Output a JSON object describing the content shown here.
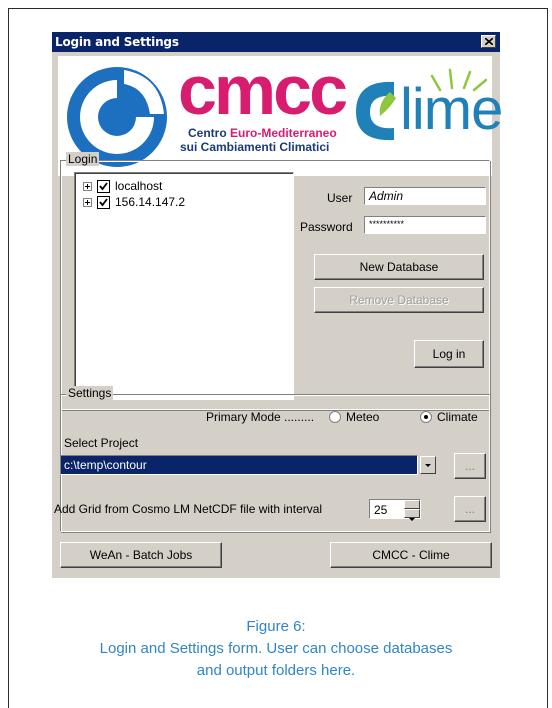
{
  "window": {
    "title": "Login and Settings",
    "close_label": "×"
  },
  "banner": {
    "cmcc_logo_text": "cmcc",
    "cmcc_subtitle_line1_a": "Centro ",
    "cmcc_subtitle_line1_b": "Euro-Mediterraneo",
    "cmcc_subtitle_line2": "sui Cambiamenti Climatici",
    "clime_logo_text": "lime",
    "colors": {
      "cmcc_magenta": "#d81c70",
      "cmcc_blue": "#1a3a7a",
      "clime_blue": "#2080b8",
      "clime_green": "#8dc63f"
    }
  },
  "login": {
    "group_label": "Login",
    "servers": [
      {
        "name": "localhost",
        "checked": true
      },
      {
        "name": "156.14.147.2",
        "checked": true
      }
    ],
    "user_label": "User",
    "user_value": "Admin",
    "password_label": "Password",
    "password_value": "**********",
    "new_database_label": "New Database",
    "remove_database_label": "Remove Database",
    "login_label": "Log in"
  },
  "settings": {
    "group_label": "Settings",
    "primary_mode_label": "Primary Mode .........",
    "mode_options": [
      "Meteo",
      "Climate"
    ],
    "selected_mode": "Climate",
    "select_project_label": "Select Project",
    "project_path": "c:\\temp\\contour",
    "browse_label": "...",
    "grid_label": "Add Grid from Cosmo LM NetCDF file with interval",
    "grid_interval": "25",
    "grid_browse_label": "..."
  },
  "footer": {
    "wean_button": "WeAn - Batch Jobs",
    "cmcc_button": "CMCC - Clime"
  },
  "caption": {
    "line1": "Figure 6:",
    "line2": "Login and Settings form. User can choose databases",
    "line3": "and output folders here."
  }
}
